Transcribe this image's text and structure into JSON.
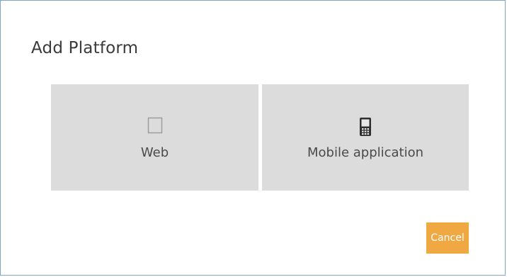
{
  "dialog": {
    "title": "Add Platform"
  },
  "platforms": [
    {
      "label": "Web",
      "icon": "browser-page-icon"
    },
    {
      "label": "Mobile application",
      "icon": "mobile-phone-icon"
    }
  ],
  "actions": {
    "cancel_label": "Cancel"
  },
  "colors": {
    "tile_background": "#dcdcdc",
    "cancel_button": "#f0a843",
    "dialog_border": "#7ea6c8"
  }
}
